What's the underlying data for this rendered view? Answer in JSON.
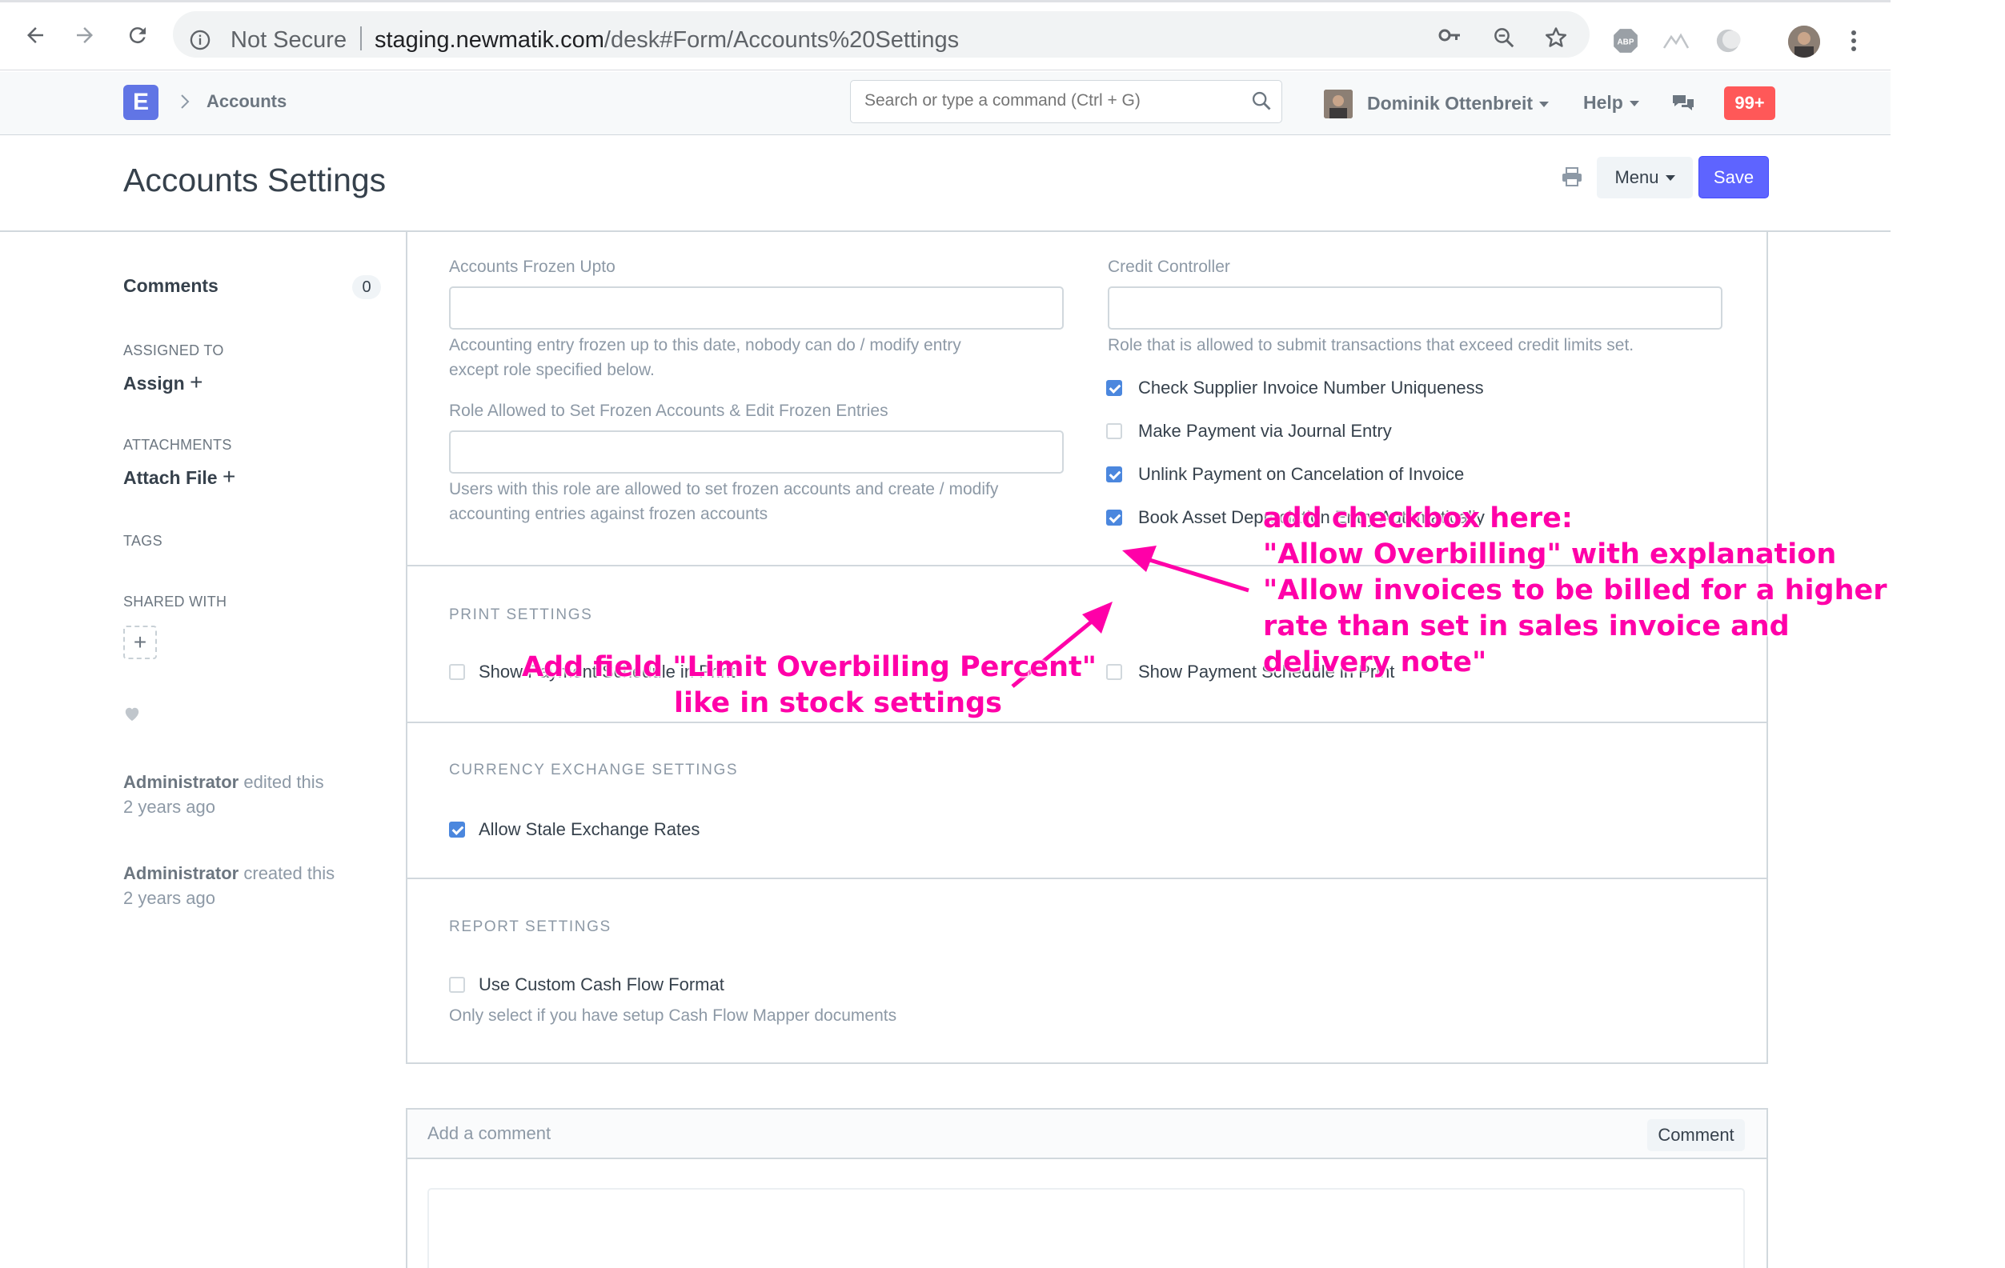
{
  "browser": {
    "security_label": "Not Secure",
    "url_host": "staging.newmatik.com",
    "url_path": "/desk#Form/Accounts%20Settings"
  },
  "navbar": {
    "logo_letter": "E",
    "breadcrumb": "Accounts",
    "search_placeholder": "Search or type a command (Ctrl + G)",
    "user_name": "Dominik Ottenbreit",
    "help_label": "Help",
    "notification_count": "99+"
  },
  "page": {
    "title": "Accounts Settings",
    "menu_label": "Menu",
    "save_label": "Save"
  },
  "sidebar": {
    "comments_label": "Comments",
    "comments_count": "0",
    "assigned_to_label": "ASSIGNED TO",
    "assign_label": "Assign",
    "attachments_label": "ATTACHMENTS",
    "attach_label": "Attach File",
    "tags_label": "TAGS",
    "shared_with_label": "SHARED WITH",
    "timeline": [
      {
        "user": "Administrator",
        "action": "edited this",
        "when": "2 years ago"
      },
      {
        "user": "Administrator",
        "action": "created this",
        "when": "2 years ago"
      }
    ]
  },
  "form": {
    "frozen_upto": {
      "label": "Accounts Frozen Upto",
      "value": "",
      "help_line1": "Accounting entry frozen up to this date, nobody can do / modify entry",
      "help_line2": "except role specified below."
    },
    "frozen_role": {
      "label": "Role Allowed to Set Frozen Accounts & Edit Frozen Entries",
      "value": "",
      "help_line1": "Users with this role are allowed to set frozen accounts and create / modify",
      "help_line2": "accounting entries against frozen accounts"
    },
    "credit_controller": {
      "label": "Credit Controller",
      "value": "",
      "help": "Role that is allowed to submit transactions that exceed credit limits set."
    },
    "checkboxes": [
      {
        "label": "Check Supplier Invoice Number Uniqueness",
        "checked": true
      },
      {
        "label": "Make Payment via Journal Entry",
        "checked": false
      },
      {
        "label": "Unlink Payment on Cancelation of Invoice",
        "checked": true
      },
      {
        "label": "Book Asset Depreciation Entry Automatically",
        "checked": true
      }
    ],
    "print_settings": {
      "heading": "PRINT SETTINGS",
      "left_label": "Show Payment Schedule in Print",
      "left_checked": false,
      "right_label": "Show Payment Schedule in Print",
      "right_checked": false
    },
    "currency_settings": {
      "heading": "CURRENCY EXCHANGE SETTINGS",
      "label": "Allow Stale Exchange Rates",
      "checked": true
    },
    "report_settings": {
      "heading": "REPORT SETTINGS",
      "label": "Use Custom Cash Flow Format",
      "checked": false,
      "help": "Only select if you have setup Cash Flow Mapper documents"
    }
  },
  "comments": {
    "placeholder": "Add a comment",
    "button_label": "Comment"
  },
  "annotations": {
    "right": [
      "add checkbox here:",
      "\"Allow Overbilling\" with explanation",
      "\"Allow invoices to be billed for a higher",
      "rate than set in sales invoice and",
      "delivery note\""
    ],
    "left": [
      "Add field \"Limit Overbilling Percent\"",
      "like in stock settings"
    ]
  },
  "colors": {
    "annotation": "#ff00a8",
    "primary": "#5e64ff",
    "checkbox": "#4b87de",
    "badge": "#ff5858"
  }
}
